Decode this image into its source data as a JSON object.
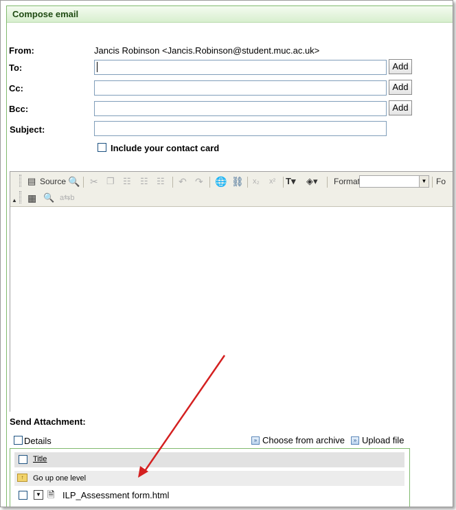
{
  "header": {
    "title": "Compose email"
  },
  "form": {
    "from_label": "From:",
    "from_value": "Jancis Robinson <Jancis.Robinson@student.muc.ac.uk>",
    "to_label": "To:",
    "to_value": "",
    "cc_label": "Cc:",
    "cc_value": "",
    "bcc_label": "Bcc:",
    "bcc_value": "",
    "subject_label": "Subject:",
    "subject_value": "",
    "add_label": "Add",
    "contact_card_label": "Include your contact card"
  },
  "toolbar": {
    "source_label": "Source",
    "format_label": "Format",
    "format_value": "",
    "font_label_cut": "Fo"
  },
  "attachments": {
    "title": "Send Attachment:",
    "details_label": "Details",
    "choose_archive_label": "Choose from archive",
    "upload_label": "Upload file",
    "column_title": "Title",
    "go_up_label": "Go up one level",
    "files": [
      {
        "name": "ILP_Assessment form.html"
      }
    ]
  },
  "colors": {
    "header_text": "#1f4b13",
    "panel_border": "#7fb96c",
    "annotation_arrow": "#d42020"
  },
  "icons": {
    "source": "source-icon",
    "preview": "preview-icon",
    "cut": "cut-icon",
    "copy": "copy-icon",
    "paste": "paste-icon",
    "paste_text": "paste-text-icon",
    "paste_word": "paste-word-icon",
    "undo": "undo-icon",
    "redo": "redo-icon",
    "link": "link-icon",
    "unlink": "unlink-icon",
    "subscript": "subscript-icon",
    "superscript": "superscript-icon",
    "text_color": "text-color-icon",
    "bg_color": "background-color-icon",
    "table": "table-icon",
    "find": "find-icon",
    "replace": "replace-icon",
    "folder_up": "folder-up-icon",
    "file": "file-icon"
  }
}
